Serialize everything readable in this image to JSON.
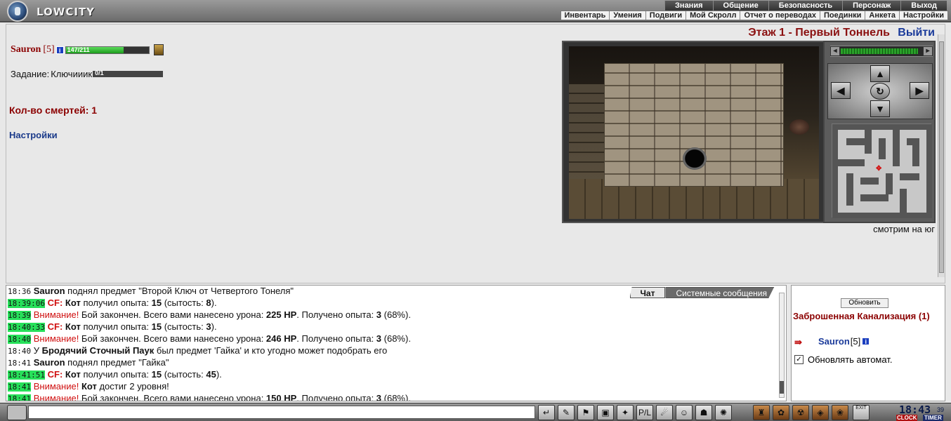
{
  "header": {
    "logo_text": "LOWCITY",
    "nav_top": [
      "Знания",
      "Общение",
      "Безопасность",
      "Персонаж",
      "Выход"
    ],
    "nav_sub": [
      "Инвентарь",
      "Умения",
      "Подвиги",
      "Мой Скролл",
      "Отчет о переводах",
      "Поединки",
      "Анкета",
      "Настройки"
    ]
  },
  "character": {
    "name": "Sauron",
    "level": "[5]",
    "info_label": "i",
    "hp_text": "147/211",
    "hp_fraction": 0.697
  },
  "task": {
    "label": "Задание:",
    "name": "Ключииик",
    "progress_text": "0/1",
    "progress_fraction": 0
  },
  "deaths_text": "Кол-во смертей: 1",
  "settings_link": "Настройки",
  "location": {
    "floor_title": "Этаж 1 - Первый Тоннель",
    "exit_label": "Выйти",
    "facing_text": "смотрим на юг"
  },
  "chat": {
    "tabs": [
      "Чат",
      "Системные сообщения"
    ],
    "messages": [
      {
        "time": "18:36",
        "highlight": false,
        "parts": [
          [
            "b",
            "Sauron"
          ],
          [
            "n",
            " поднял предмет \"Второй Ключ от Четвертого Тонеля\""
          ]
        ]
      },
      {
        "time": "18:39:06",
        "highlight": true,
        "parts": [
          [
            "redb",
            "CF:"
          ],
          [
            "n",
            " "
          ],
          [
            "b",
            "Кот"
          ],
          [
            "n",
            " получил опыта: "
          ],
          [
            "b",
            "15"
          ],
          [
            "n",
            " (сытость: "
          ],
          [
            "b",
            "8"
          ],
          [
            "n",
            "). "
          ]
        ]
      },
      {
        "time": "18:39",
        "highlight": true,
        "parts": [
          [
            "red",
            "Внимание!"
          ],
          [
            "n",
            " Бой закончен. Всего вами нанесено урона: "
          ],
          [
            "b",
            "225 HP"
          ],
          [
            "n",
            ". Получено опыта: "
          ],
          [
            "b",
            "3"
          ],
          [
            "n",
            " (68%)."
          ]
        ]
      },
      {
        "time": "18:40:33",
        "highlight": true,
        "parts": [
          [
            "redb",
            "CF:"
          ],
          [
            "n",
            " "
          ],
          [
            "b",
            "Кот"
          ],
          [
            "n",
            " получил опыта: "
          ],
          [
            "b",
            "15"
          ],
          [
            "n",
            " (сытость: "
          ],
          [
            "b",
            "3"
          ],
          [
            "n",
            "). "
          ]
        ]
      },
      {
        "time": "18:40",
        "highlight": true,
        "parts": [
          [
            "red",
            "Внимание!"
          ],
          [
            "n",
            " Бой закончен. Всего вами нанесено урона: "
          ],
          [
            "b",
            "246 HP"
          ],
          [
            "n",
            ". Получено опыта: "
          ],
          [
            "b",
            "3"
          ],
          [
            "n",
            " (68%)."
          ]
        ]
      },
      {
        "time": "18:40",
        "highlight": false,
        "parts": [
          [
            "n",
            "У "
          ],
          [
            "b",
            "Бродячий Сточный Паук"
          ],
          [
            "n",
            " был предмет 'Гайка' и кто угодно может подобрать его"
          ]
        ]
      },
      {
        "time": "18:41",
        "highlight": false,
        "parts": [
          [
            "b",
            "Sauron"
          ],
          [
            "n",
            " поднял предмет \"Гайка\""
          ]
        ]
      },
      {
        "time": "18:41:51",
        "highlight": true,
        "parts": [
          [
            "redb",
            "CF:"
          ],
          [
            "n",
            " "
          ],
          [
            "b",
            "Кот"
          ],
          [
            "n",
            " получил опыта: "
          ],
          [
            "b",
            "15"
          ],
          [
            "n",
            " (сытость: "
          ],
          [
            "b",
            "45"
          ],
          [
            "n",
            "). "
          ]
        ]
      },
      {
        "time": "18:41",
        "highlight": true,
        "parts": [
          [
            "red",
            "Внимание!"
          ],
          [
            "n",
            " "
          ],
          [
            "b",
            "Кот"
          ],
          [
            "n",
            " достиг 2 уровня!"
          ]
        ]
      },
      {
        "time": "18:41",
        "highlight": true,
        "parts": [
          [
            "red",
            "Внимание!"
          ],
          [
            "n",
            " Бой закончен. Всего вами нанесено урона: "
          ],
          [
            "b",
            "150 HP"
          ],
          [
            "n",
            ". Получено опыта: "
          ],
          [
            "b",
            "3"
          ],
          [
            "n",
            " (68%)."
          ]
        ]
      }
    ]
  },
  "side": {
    "refresh_label": "Обновить",
    "location_name": "Заброшенная Канализация (1)",
    "player_name": "Sauron",
    "player_level": "[5]",
    "auto_update_label": "Обновлять автомат.",
    "auto_update_checked": "✓"
  },
  "toolbar": {
    "input_value": "",
    "buttons": [
      "↵",
      "✎",
      "⚑",
      "▣",
      "✦",
      "P/L",
      "☄",
      "☺",
      "☗",
      "✺",
      "♜",
      "✿",
      "☢",
      "◈",
      "❀"
    ],
    "exit_small": "EXIT"
  },
  "clock": {
    "time": "18:43",
    "seconds": "39",
    "clock_label": "CLOCK",
    "timer_label": "TIMER"
  }
}
